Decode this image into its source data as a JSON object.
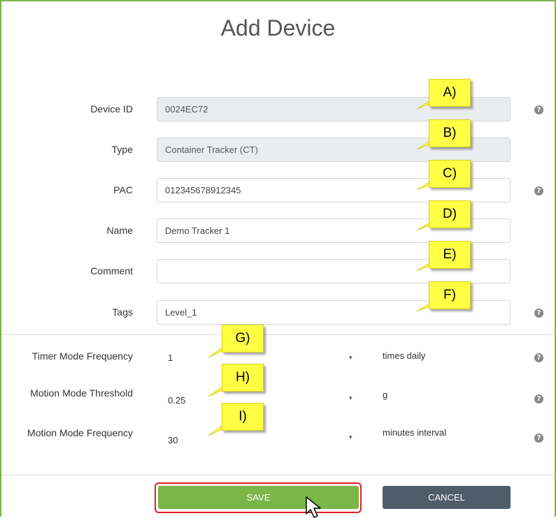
{
  "title": "Add Device",
  "fields": [
    {
      "label": "Device ID",
      "value": "0024EC72",
      "disabled": true,
      "help": true
    },
    {
      "label": "Type",
      "value": "Container Tracker (CT)",
      "disabled": true,
      "help": false
    },
    {
      "label": "PAC",
      "value": "012345678912345",
      "disabled": false,
      "help": true
    },
    {
      "label": "Name",
      "value": "Demo Tracker 1",
      "disabled": false,
      "help": false
    },
    {
      "label": "Comment",
      "value": "",
      "disabled": false,
      "help": false
    },
    {
      "label": "Tags",
      "value": "Level_1",
      "disabled": false,
      "help": true
    }
  ],
  "settings": [
    {
      "label": "Timer Mode Frequency",
      "value": "1",
      "unit": "times daily"
    },
    {
      "label": "Motion Mode Threshold",
      "value": "0.25",
      "unit": "g"
    },
    {
      "label": "Motion Mode Frequency",
      "value": "30",
      "unit": "minutes interval"
    }
  ],
  "callouts": [
    "A)",
    "B)",
    "C)",
    "D)",
    "E)",
    "F)",
    "G)",
    "H)",
    "I)"
  ],
  "help_glyph": "?",
  "caret_glyph": "▾",
  "buttons": {
    "save": "SAVE",
    "cancel": "CANCEL"
  },
  "colors": {
    "accent_green": "#7ab648",
    "save_bg": "#7ab648",
    "cancel_bg": "#4f5d6b",
    "highlight_red": "#e02020",
    "callout_yellow": "#ffff44"
  }
}
